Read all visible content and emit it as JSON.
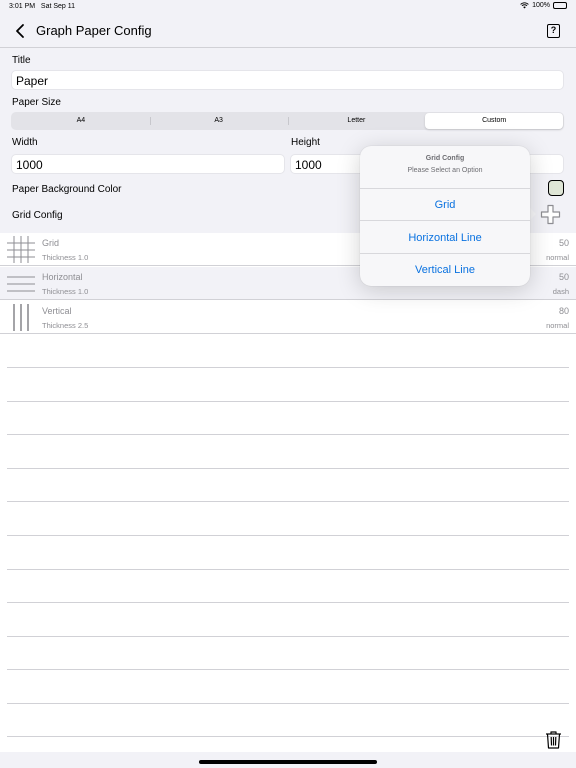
{
  "status_bar": {
    "time": "3:01 PM",
    "date": "Sat Sep 11",
    "battery": "100%",
    "wifi_icon": "wifi-icon",
    "battery_icon": "battery-icon"
  },
  "nav": {
    "back_icon": "chevron-left-icon",
    "title": "Graph Paper Config",
    "help_label": "?"
  },
  "form": {
    "title_label": "Title",
    "title_value": "Paper",
    "paper_size_label": "Paper Size",
    "paper_sizes": [
      "A4",
      "A3",
      "Letter",
      "Custom"
    ],
    "selected_size": "Custom",
    "width_label": "Width",
    "width_value": "1000",
    "height_label": "Height",
    "height_value": "1000",
    "bg_color_label": "Paper Background Color",
    "bg_color": "#dfe6d6",
    "grid_config_label": "Grid Config",
    "add_icon": "plus-icon"
  },
  "grid_list": [
    {
      "icon": "grid-lines-icon",
      "title": "Grid",
      "thickness": "Thickness 1.0",
      "value": "50",
      "style": "normal"
    },
    {
      "icon": "horizontal-lines-icon",
      "title": "Horizontal",
      "thickness": "Thickness 1.0",
      "value": "50",
      "style": "dash"
    },
    {
      "icon": "vertical-lines-icon",
      "title": "Vertical",
      "thickness": "Thickness 2.5",
      "value": "80",
      "style": "normal"
    }
  ],
  "popover": {
    "title": "Grid Config",
    "message": "Please Select an Option",
    "options": [
      "Grid",
      "Horizontal Line",
      "Vertical Line"
    ]
  },
  "footer": {
    "trash_icon": "trash-icon"
  },
  "colors": {
    "accent": "#0a72e0",
    "background": "#f2f2f7",
    "separator": "#d1d1d6",
    "secondary_text": "#8e8e93"
  }
}
